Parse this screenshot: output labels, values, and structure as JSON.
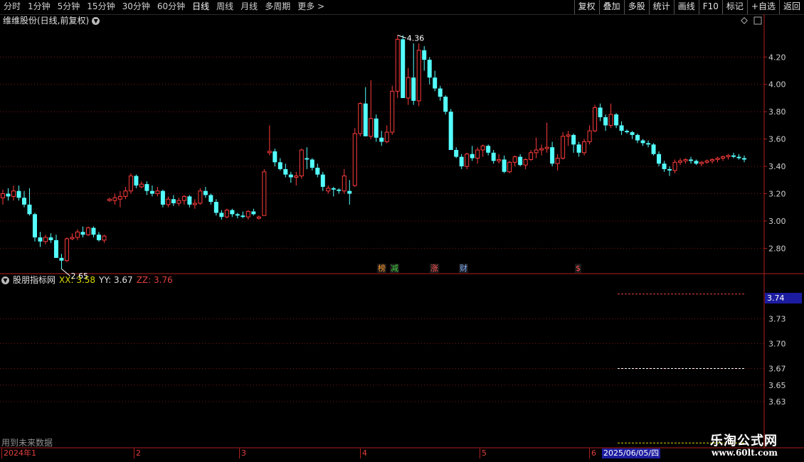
{
  "toolbar": {
    "tabs": [
      "分时",
      "1分钟",
      "5分钟",
      "15分钟",
      "30分钟",
      "60分钟",
      "日线",
      "周线",
      "月线",
      "多周期",
      "更多 >"
    ],
    "active_tab": "日线",
    "tools": [
      "复权",
      "叠加",
      "多股",
      "统计",
      "画线",
      "F10",
      "标记",
      "+自选",
      "返回"
    ]
  },
  "main_chart": {
    "title": "维维股份(日线,前复权)",
    "high_label": "4.36",
    "low_label": "2.65",
    "tags": [
      {
        "text": "榜",
        "color": "#ff9a2a"
      },
      {
        "text": "减",
        "color": "#40d040"
      },
      {
        "text": "涨",
        "color": "#ff5050"
      },
      {
        "text": "财",
        "color": "#80b0ff"
      },
      {
        "text": "$",
        "color": "#ff5050"
      }
    ]
  },
  "indicator": {
    "name": "股朋指标网",
    "xx": "XX: 3.58",
    "yy": "YY: 3.67",
    "zz": "ZZ: 3.76",
    "current_value": "3.74",
    "future_note": "用到未来数据"
  },
  "date_axis": {
    "labels": [
      "2024年1",
      "2",
      "3",
      "4",
      "5",
      "6"
    ],
    "current_date": "2025/06/05/四"
  },
  "watermark": {
    "title": "乐淘公式网",
    "url": "www.60lt.com"
  },
  "chart_data": {
    "type": "candlestick",
    "ylim_main": [
      2.62,
      4.42
    ],
    "yticks_main": [
      "4.20",
      "4.00",
      "3.80",
      "3.60",
      "3.40",
      "3.20",
      "3.00",
      "2.80"
    ],
    "ylim_indicator": [
      3.6,
      3.77
    ],
    "yticks_indicator": [
      "3.73",
      "3.70",
      "3.67",
      "3.65",
      "3.63"
    ],
    "indicator_lines": [
      {
        "name": "XX",
        "value": 3.58,
        "color": "#d8d800"
      },
      {
        "name": "YY",
        "value": 3.67,
        "color": "#ffffff"
      },
      {
        "name": "ZZ",
        "value": 3.76,
        "color": "#e04040"
      }
    ],
    "ohlc": [
      [
        3.17,
        3.23,
        3.12,
        3.2
      ],
      [
        3.2,
        3.24,
        3.15,
        3.18
      ],
      [
        3.18,
        3.26,
        3.15,
        3.22
      ],
      [
        3.22,
        3.26,
        3.15,
        3.17
      ],
      [
        3.17,
        3.22,
        3.1,
        3.12
      ],
      [
        3.12,
        3.24,
        3.04,
        3.05
      ],
      [
        3.05,
        3.06,
        2.85,
        2.88
      ],
      [
        2.88,
        2.92,
        2.81,
        2.85
      ],
      [
        2.85,
        2.9,
        2.83,
        2.88
      ],
      [
        2.88,
        2.91,
        2.84,
        2.86
      ],
      [
        2.86,
        2.9,
        2.78,
        2.73
      ],
      [
        2.73,
        2.76,
        2.65,
        2.71
      ],
      [
        2.71,
        2.88,
        2.7,
        2.87
      ],
      [
        2.87,
        2.91,
        2.86,
        2.88
      ],
      [
        2.88,
        2.94,
        2.86,
        2.92
      ],
      [
        2.92,
        2.96,
        2.88,
        2.9
      ],
      [
        2.9,
        2.96,
        2.89,
        2.95
      ],
      [
        2.95,
        2.96,
        2.88,
        2.9
      ],
      [
        2.9,
        2.92,
        2.85,
        2.86
      ],
      [
        2.86,
        2.9,
        2.84,
        2.89
      ],
      [
        3.15,
        3.17,
        3.14,
        3.16
      ],
      [
        3.15,
        3.2,
        3.12,
        3.17
      ],
      [
        3.16,
        3.22,
        3.1,
        3.18
      ],
      [
        3.18,
        3.25,
        3.16,
        3.22
      ],
      [
        3.22,
        3.35,
        3.2,
        3.33
      ],
      [
        3.33,
        3.34,
        3.24,
        3.26
      ],
      [
        3.25,
        3.29,
        3.24,
        3.27
      ],
      [
        3.27,
        3.29,
        3.19,
        3.22
      ],
      [
        3.22,
        3.26,
        3.18,
        3.2
      ],
      [
        3.2,
        3.25,
        3.18,
        3.22
      ],
      [
        3.22,
        3.23,
        3.1,
        3.12
      ],
      [
        3.12,
        3.18,
        3.1,
        3.16
      ],
      [
        3.16,
        3.19,
        3.11,
        3.13
      ],
      [
        3.13,
        3.17,
        3.11,
        3.15
      ],
      [
        3.15,
        3.19,
        3.12,
        3.18
      ],
      [
        3.18,
        3.19,
        3.1,
        3.12
      ],
      [
        3.12,
        3.16,
        3.09,
        3.13
      ],
      [
        3.13,
        3.24,
        3.12,
        3.22
      ],
      [
        3.22,
        3.25,
        3.17,
        3.19
      ],
      [
        3.19,
        3.2,
        3.12,
        3.14
      ],
      [
        3.14,
        3.16,
        3.04,
        3.06
      ],
      [
        3.06,
        3.08,
        3.01,
        3.03
      ],
      [
        3.03,
        3.09,
        3.02,
        3.08
      ],
      [
        3.08,
        3.09,
        3.03,
        3.05
      ],
      [
        3.05,
        3.06,
        3.02,
        3.04
      ],
      [
        3.04,
        3.07,
        3.02,
        3.03
      ],
      [
        3.03,
        3.08,
        3.01,
        3.07
      ],
      [
        3.07,
        3.09,
        3.04,
        3.05
      ],
      [
        3.02,
        3.04,
        3.01,
        3.03
      ],
      [
        3.04,
        3.38,
        3.04,
        3.36
      ],
      [
        3.5,
        3.7,
        3.48,
        3.51
      ],
      [
        3.51,
        3.53,
        3.4,
        3.43
      ],
      [
        3.43,
        3.46,
        3.37,
        3.38
      ],
      [
        3.38,
        3.42,
        3.32,
        3.34
      ],
      [
        3.34,
        3.36,
        3.28,
        3.32
      ],
      [
        3.32,
        3.36,
        3.26,
        3.33
      ],
      [
        3.33,
        3.53,
        3.31,
        3.52
      ],
      [
        3.46,
        3.54,
        3.38,
        3.45
      ],
      [
        3.45,
        3.46,
        3.37,
        3.39
      ],
      [
        3.39,
        3.42,
        3.32,
        3.34
      ],
      [
        3.34,
        3.36,
        3.22,
        3.25
      ],
      [
        3.22,
        3.26,
        3.2,
        3.24
      ],
      [
        3.24,
        3.25,
        3.18,
        3.23
      ],
      [
        3.23,
        3.24,
        3.2,
        3.22
      ],
      [
        3.22,
        3.38,
        3.2,
        3.33
      ],
      [
        3.22,
        3.3,
        3.12,
        3.2
      ],
      [
        3.26,
        3.68,
        3.25,
        3.64
      ],
      [
        3.64,
        3.87,
        3.62,
        3.86
      ],
      [
        3.86,
        3.98,
        3.65,
        3.62
      ],
      [
        3.62,
        4.03,
        3.6,
        3.75
      ],
      [
        3.75,
        3.78,
        3.58,
        3.61
      ],
      [
        3.61,
        3.66,
        3.55,
        3.58
      ],
      [
        3.58,
        3.7,
        3.57,
        3.65
      ],
      [
        3.65,
        3.99,
        3.63,
        3.95
      ],
      [
        3.95,
        4.36,
        3.9,
        4.33
      ],
      [
        4.33,
        4.36,
        4.02,
        3.9
      ],
      [
        3.9,
        4.12,
        3.85,
        4.05
      ],
      [
        4.05,
        4.3,
        3.85,
        3.88
      ],
      [
        3.88,
        4.3,
        3.84,
        4.25
      ],
      [
        4.25,
        4.28,
        4.1,
        4.18
      ],
      [
        4.18,
        4.2,
        4.0,
        4.05
      ],
      [
        4.05,
        4.1,
        3.95,
        3.97
      ],
      [
        3.97,
        3.99,
        3.88,
        3.91
      ],
      [
        3.91,
        3.92,
        3.78,
        3.8
      ],
      [
        3.8,
        3.82,
        3.55,
        3.52
      ],
      [
        3.52,
        3.54,
        3.46,
        3.47
      ],
      [
        3.47,
        3.49,
        3.38,
        3.4
      ],
      [
        3.4,
        3.5,
        3.38,
        3.49
      ],
      [
        3.49,
        3.55,
        3.44,
        3.46
      ],
      [
        3.46,
        3.54,
        3.42,
        3.52
      ],
      [
        3.52,
        3.56,
        3.47,
        3.55
      ],
      [
        3.55,
        3.56,
        3.48,
        3.5
      ],
      [
        3.5,
        3.52,
        3.42,
        3.44
      ],
      [
        3.44,
        3.49,
        3.42,
        3.45
      ],
      [
        3.45,
        3.48,
        3.35,
        3.36
      ],
      [
        3.36,
        3.44,
        3.35,
        3.43
      ],
      [
        3.43,
        3.48,
        3.4,
        3.47
      ],
      [
        3.47,
        3.49,
        3.4,
        3.41
      ],
      [
        3.41,
        3.46,
        3.38,
        3.45
      ],
      [
        3.45,
        3.52,
        3.44,
        3.5
      ],
      [
        3.5,
        3.61,
        3.46,
        3.52
      ],
      [
        3.52,
        3.56,
        3.48,
        3.53
      ],
      [
        3.53,
        3.72,
        3.5,
        3.54
      ],
      [
        3.54,
        3.58,
        3.4,
        3.42
      ],
      [
        3.42,
        3.49,
        3.37,
        3.46
      ],
      [
        3.46,
        3.65,
        3.45,
        3.62
      ],
      [
        3.62,
        3.66,
        3.55,
        3.63
      ],
      [
        3.63,
        3.64,
        3.5,
        3.56
      ],
      [
        3.56,
        3.58,
        3.47,
        3.5
      ],
      [
        3.5,
        3.6,
        3.48,
        3.58
      ],
      [
        3.58,
        3.7,
        3.56,
        3.66
      ],
      [
        3.66,
        3.85,
        3.65,
        3.83
      ],
      [
        3.83,
        3.86,
        3.73,
        3.76
      ],
      [
        3.76,
        3.78,
        3.66,
        3.7
      ],
      [
        3.7,
        3.86,
        3.68,
        3.78
      ],
      [
        3.78,
        3.79,
        3.68,
        3.7
      ],
      [
        3.7,
        3.73,
        3.63,
        3.66
      ],
      [
        3.66,
        3.67,
        3.64,
        3.65
      ],
      [
        3.65,
        3.66,
        3.6,
        3.63
      ],
      [
        3.63,
        3.64,
        3.57,
        3.59
      ],
      [
        3.59,
        3.6,
        3.55,
        3.57
      ],
      [
        3.57,
        3.59,
        3.54,
        3.56
      ],
      [
        3.56,
        3.57,
        3.48,
        3.49
      ],
      [
        3.49,
        3.51,
        3.4,
        3.42
      ],
      [
        3.42,
        3.44,
        3.36,
        3.38
      ],
      [
        3.38,
        3.4,
        3.33,
        3.37
      ],
      [
        3.37,
        3.45,
        3.35,
        3.43
      ],
      [
        3.43,
        3.46,
        3.41,
        3.44
      ],
      [
        3.44,
        3.46,
        3.42,
        3.45
      ],
      [
        3.45,
        3.47,
        3.42,
        3.44
      ],
      [
        3.44,
        3.45,
        3.41,
        3.42
      ],
      [
        3.42,
        3.44,
        3.4,
        3.43
      ],
      [
        3.43,
        3.45,
        3.42,
        3.44
      ],
      [
        3.44,
        3.46,
        3.42,
        3.45
      ],
      [
        3.45,
        3.47,
        3.43,
        3.46
      ],
      [
        3.46,
        3.48,
        3.44,
        3.47
      ],
      [
        3.47,
        3.49,
        3.45,
        3.48
      ],
      [
        3.48,
        3.5,
        3.46,
        3.47
      ],
      [
        3.47,
        3.49,
        3.45,
        3.46
      ],
      [
        3.46,
        3.48,
        3.43,
        3.45
      ]
    ]
  }
}
